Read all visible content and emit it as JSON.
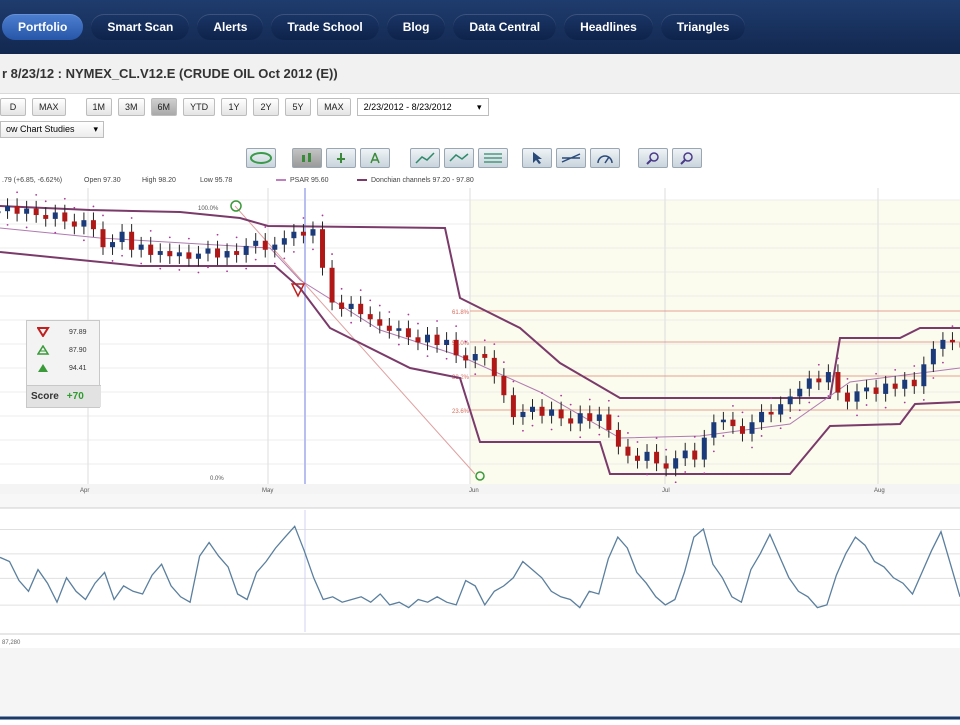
{
  "nav": {
    "items": [
      "Portfolio",
      "Smart Scan",
      "Alerts",
      "Trade School",
      "Blog",
      "Data Central",
      "Headlines",
      "Triangles"
    ],
    "active_index": 0
  },
  "title": "r 8/23/12 : NYMEX_CL.V12.E (CRUDE OIL Oct 2012 (E))",
  "range_buttons_left": [
    "D",
    "MAX"
  ],
  "range_buttons": [
    "1M",
    "3M",
    "6M",
    "YTD",
    "1Y",
    "2Y",
    "5Y",
    "MAX"
  ],
  "range_active": "6M",
  "date_range": "2/23/2012 - 8/23/2012",
  "study_select": "ow Chart Studies",
  "legend": {
    "quote": ".79 (+6.85, -6.62%)",
    "open": "Open 97.30",
    "high": "High 98.20",
    "low": "Low 95.78",
    "psar": "PSAR 95.60",
    "donchian": "Donchian channels 97.20 - 97.80"
  },
  "chart_labels": {
    "fib_top": "100.0%",
    "fib_618": "61.8%",
    "fib_50": "50.0%",
    "fib_382": "38.2%",
    "fib_236": "23.6%",
    "fib_0": "0.0%",
    "months": [
      "Apr",
      "May",
      "Jun",
      "Jul",
      "Aug"
    ],
    "osc_label": "87,280"
  },
  "score_panel": {
    "rows": [
      "97.89",
      "87.90",
      "94.41"
    ],
    "label": "Score",
    "value": "+70"
  },
  "colors": {
    "nav_bg": "#13294f",
    "nav_active": "#3a6cc0",
    "donchian": "#7a3a6a",
    "fib": "#d86a5a",
    "oscillator": "#5a7f9e",
    "candle_up": "#1a3a7a",
    "candle_down": "#b01818"
  },
  "chart_data": [
    {
      "type": "candlestick",
      "series": [
        {
          "name": "NYMEX_CL.V12.E",
          "values": [
            104.2,
            104.6,
            104.0,
            104.4,
            103.9,
            103.6,
            104.1,
            103.4,
            103.0,
            103.5,
            102.8,
            101.4,
            101.8,
            102.6,
            101.2,
            101.6,
            100.8,
            101.1,
            100.7,
            101.0,
            100.5,
            100.9,
            101.3,
            100.6,
            101.1,
            100.8,
            101.5,
            101.9,
            101.2,
            101.6,
            102.1,
            102.6,
            102.3,
            102.8,
            99.8,
            97.1,
            96.6,
            97.0,
            96.2,
            95.8,
            95.3,
            94.9,
            95.1,
            94.4,
            94.0,
            94.6,
            93.8,
            94.2,
            93.0,
            92.6,
            93.1,
            92.8,
            91.4,
            89.9,
            88.2,
            88.6,
            89.0,
            88.3,
            88.8,
            88.1,
            87.7,
            88.5,
            87.9,
            88.4,
            87.2,
            85.9,
            85.2,
            84.8,
            85.5,
            84.6,
            84.2,
            85.0,
            85.6,
            84.9,
            86.6,
            87.8,
            88.0,
            87.5,
            86.9,
            87.8,
            88.6,
            88.4,
            89.2,
            89.8,
            90.4,
            91.2,
            90.9,
            91.7,
            90.1,
            89.4,
            90.2,
            90.5,
            90.0,
            90.8,
            90.4,
            91.1,
            90.6,
            92.3,
            93.5,
            94.2,
            94.0,
            93.6
          ]
        }
      ],
      "overlays": [
        "PSAR",
        "Donchian channels"
      ]
    },
    {
      "type": "line",
      "series": [
        {
          "name": "",
          "values": [
            55,
            52,
            38,
            30,
            46,
            36,
            22,
            40,
            30,
            24,
            36,
            44,
            24,
            34,
            30,
            28,
            42,
            50,
            34,
            26,
            22,
            56,
            66,
            56,
            48,
            28,
            24,
            44,
            52,
            62,
            70,
            78,
            60,
            40,
            24,
            26,
            22,
            24,
            26,
            22,
            28,
            20,
            22,
            18,
            24,
            22,
            26,
            22,
            20,
            38,
            34,
            20,
            30,
            34,
            40,
            52,
            46,
            40,
            30,
            26,
            24,
            18,
            30,
            28,
            54,
            70,
            62,
            44,
            36,
            26,
            20,
            24,
            44,
            70,
            76,
            50,
            40,
            26,
            22,
            46,
            58,
            72,
            56,
            40,
            30,
            26,
            18,
            20,
            42,
            58,
            70,
            64,
            52,
            48,
            40,
            36,
            28,
            44,
            60,
            74,
            50,
            26
          ]
        }
      ]
    }
  ]
}
